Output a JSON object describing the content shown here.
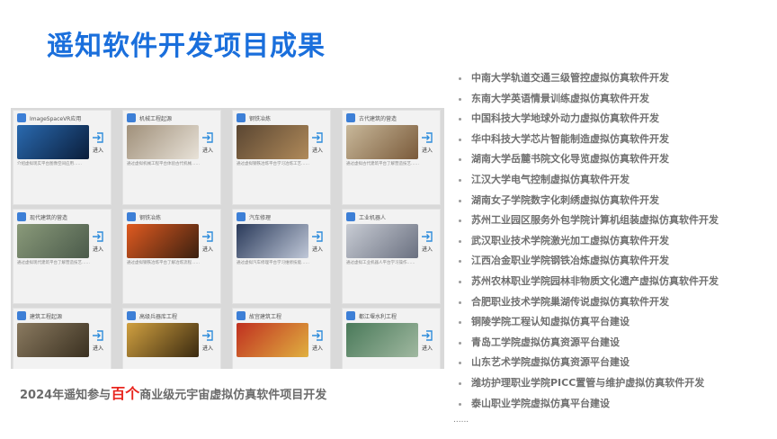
{
  "slide": {
    "title": "遥知软件开发项目成果",
    "caption_before": "2024年遥知参与",
    "caption_highlight": "百个",
    "caption_after": "商业级元宇宙虚拟仿真软件项目开发",
    "more": "......"
  },
  "cards": [
    {
      "title": "ImageSpaceVR应用",
      "enter": "进入",
      "desc": "介绍虚拟现实平台图像空间应用……",
      "thumb": "#2a6ab0",
      "thumb2": "#0a1d3a"
    },
    {
      "title": "机械工程起源",
      "enter": "进入",
      "desc": "通过虚拟机械工程平台体验古代机械……",
      "thumb": "#a0907a",
      "thumb2": "#e8e2d8"
    },
    {
      "title": "钢铁冶炼",
      "enter": "进入",
      "desc": "通过虚拟钢铁冶炼平台学习冶炼工艺……",
      "thumb": "#5a4632",
      "thumb2": "#b08a5a"
    },
    {
      "title": "古代建筑的营造",
      "enter": "进入",
      "desc": "通过虚拟古代建筑平台了解营造技艺……",
      "thumb": "#c8b89a",
      "thumb2": "#7a5a3a"
    },
    {
      "title": "现代建筑的营造",
      "enter": "进入",
      "desc": "通过虚拟现代建筑平台了解营造技艺……",
      "thumb": "#8a9a7a",
      "thumb2": "#4a5a4a"
    },
    {
      "title": "钢铁冶炼",
      "enter": "进入",
      "desc": "通过虚拟钢铁冶炼平台了解冶炼流程……",
      "thumb": "#e05a20",
      "thumb2": "#3a2010"
    },
    {
      "title": "汽车修理",
      "enter": "进入",
      "desc": "通过虚拟汽车修理平台学习维修技能……",
      "thumb": "#2a3a5a",
      "thumb2": "#c0c8d8"
    },
    {
      "title": "工业机器人",
      "enter": "进入",
      "desc": "通过虚拟工业机器人平台学习操作……",
      "thumb": "#c8ccd4",
      "thumb2": "#6a7080"
    },
    {
      "title": "建筑工程起源",
      "enter": "进入",
      "desc": "",
      "thumb": "#8a7a60",
      "thumb2": "#3a3020"
    },
    {
      "title": "高级兵器库工程",
      "enter": "进入",
      "desc": "",
      "thumb": "#d0a040",
      "thumb2": "#3a2a10"
    },
    {
      "title": "故宫建筑工程",
      "enter": "进入",
      "desc": "",
      "thumb": "#c03020",
      "thumb2": "#e0b040"
    },
    {
      "title": "都江堰水利工程",
      "enter": "进入",
      "desc": "",
      "thumb": "#4a7a5a",
      "thumb2": "#a0b8a0"
    }
  ],
  "projects": [
    "中南大学轨道交通三级管控虚拟仿真软件开发",
    "东南大学英语情景训练虚拟仿真软件开发",
    "中国科技大学地球外动力虚拟仿真软件开发",
    "华中科技大学芯片智能制造虚拟仿真软件开发",
    "湖南大学岳麓书院文化导览虚拟仿真软件开发",
    "江汉大学电气控制虚拟仿真软件开发",
    "湖南女子学院数字化刺绣虚拟仿真软件开发",
    "苏州工业园区服务外包学院计算机组装虚拟仿真软件开发",
    "武汉职业技术学院激光加工虚拟仿真软件开发",
    "江西冶金职业学院钢铁冶炼虚拟仿真软件开发",
    "苏州农林职业学院园林非物质文化遗产虚拟仿真软件开发",
    "合肥职业技术学院巢湖传说虚拟仿真软件开发",
    "铜陵学院工程认知虚拟仿真平台建设",
    "青岛工学院虚拟仿真资源平台建设",
    "山东艺术学院虚拟仿真资源平台建设",
    "潍坊护理职业学院PICC置管与维护虚拟仿真软件开发",
    "泰山职业学院虚拟仿真平台建设"
  ],
  "colors": {
    "title": "#1a6fdc",
    "highlight": "#e8251e",
    "icon_blue": "#3d7fd6"
  }
}
